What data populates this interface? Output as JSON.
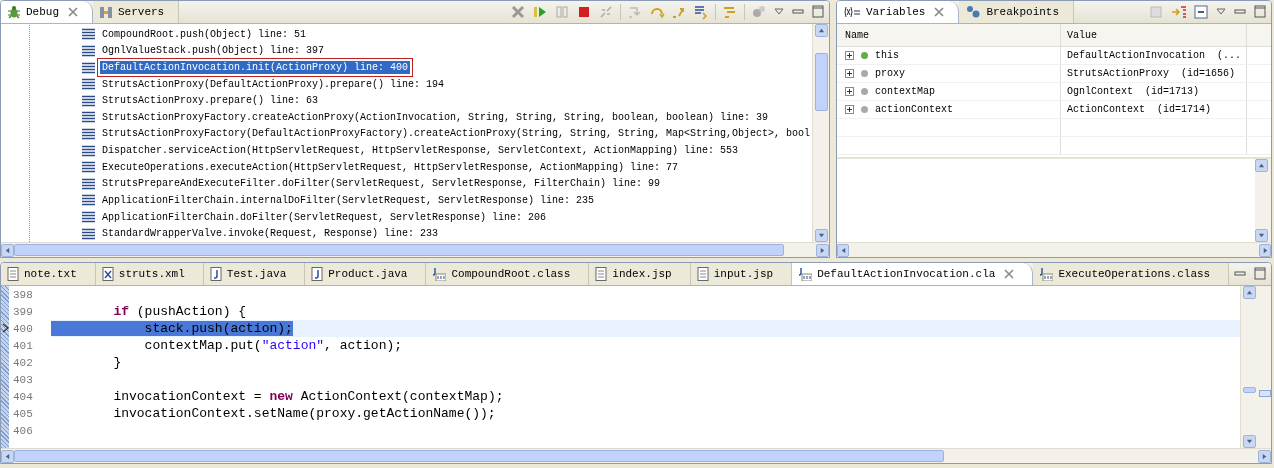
{
  "debug_view": {
    "tabs": [
      {
        "label": "Debug",
        "selected": true
      },
      {
        "label": "Servers",
        "selected": false
      }
    ],
    "frames": [
      {
        "text": "CompoundRoot.push(Object) line: 51",
        "selected": false
      },
      {
        "text": "OgnlValueStack.push(Object) line: 397",
        "selected": false
      },
      {
        "text": "DefaultActionInvocation.init(ActionProxy) line: 400",
        "selected": true
      },
      {
        "text": "StrutsActionProxy(DefaultActionProxy).prepare() line: 194",
        "selected": false
      },
      {
        "text": "StrutsActionProxy.prepare() line: 63",
        "selected": false
      },
      {
        "text": "StrutsActionProxyFactory.createActionProxy(ActionInvocation, String, String, String, boolean, boolean) line: 39",
        "selected": false
      },
      {
        "text": "StrutsActionProxyFactory(DefaultActionProxyFactory).createActionProxy(String, String, String, Map<String,Object>, bool",
        "selected": false
      },
      {
        "text": "Dispatcher.serviceAction(HttpServletRequest, HttpServletResponse, ServletContext, ActionMapping) line: 553",
        "selected": false
      },
      {
        "text": "ExecuteOperations.executeAction(HttpServletRequest, HttpServletResponse, ActionMapping) line: 77",
        "selected": false
      },
      {
        "text": "StrutsPrepareAndExecuteFilter.doFilter(ServletRequest, ServletResponse, FilterChain) line: 99",
        "selected": false
      },
      {
        "text": "ApplicationFilterChain.internalDoFilter(ServletRequest, ServletResponse) line: 235",
        "selected": false
      },
      {
        "text": "ApplicationFilterChain.doFilter(ServletRequest, ServletResponse) line: 206",
        "selected": false
      },
      {
        "text": "StandardWrapperValve.invoke(Request, Response) line: 233",
        "selected": false
      }
    ]
  },
  "variables_view": {
    "tabs": [
      {
        "label": "Variables",
        "selected": true
      },
      {
        "label": "Breakpoints",
        "selected": false
      }
    ],
    "columns": [
      "Name",
      "Value"
    ],
    "rows": [
      {
        "name": "this",
        "value": "DefaultActionInvocation  (...",
        "color": "#5fae4a"
      },
      {
        "name": "proxy",
        "value": "StrutsActionProxy  (id=1656)",
        "color": "#a9a9a9"
      },
      {
        "name": "contextMap",
        "value": "OgnlContext  (id=1713)",
        "color": "#a9a9a9"
      },
      {
        "name": "actionContext",
        "value": "ActionContext  (id=1714)",
        "color": "#a9a9a9"
      }
    ]
  },
  "editor": {
    "tabs": [
      {
        "label": "note.txt",
        "kind": "text",
        "selected": false
      },
      {
        "label": "struts.xml",
        "kind": "xml",
        "selected": false
      },
      {
        "label": "Test.java",
        "kind": "java",
        "selected": false
      },
      {
        "label": "Product.java",
        "kind": "java",
        "selected": false
      },
      {
        "label": "CompoundRoot.class",
        "kind": "class",
        "selected": false
      },
      {
        "label": "index.jsp",
        "kind": "text",
        "selected": false
      },
      {
        "label": "input.jsp",
        "kind": "text",
        "selected": false
      },
      {
        "label": "DefaultActionInvocation.cla",
        "kind": "class",
        "selected": true
      },
      {
        "label": "ExecuteOperations.class",
        "kind": "class",
        "selected": false
      }
    ],
    "lines": [
      {
        "number": "398",
        "current": false
      },
      {
        "number": "399",
        "current": false,
        "tokens": [
          {
            "text": "        if",
            "kind": "keyword",
            "selected": false
          },
          {
            "text": " (pushAction) {",
            "kind": "plain",
            "selected": false
          }
        ]
      },
      {
        "number": "400",
        "current": true,
        "tokens": [
          {
            "text": "            stack.push(action);",
            "kind": "plain",
            "selected": true
          }
        ]
      },
      {
        "number": "401",
        "current": false,
        "tokens": [
          {
            "text": "            contextMap.put(",
            "kind": "plain",
            "selected": false
          },
          {
            "text": "\"action\"",
            "kind": "string",
            "selected": false
          },
          {
            "text": ", action);",
            "kind": "plain",
            "selected": false
          }
        ]
      },
      {
        "number": "402",
        "current": false,
        "tokens": [
          {
            "text": "        }",
            "kind": "plain",
            "selected": false
          }
        ]
      },
      {
        "number": "403",
        "current": false
      },
      {
        "number": "404",
        "current": false,
        "tokens": [
          {
            "text": "        invocationContext = ",
            "kind": "plain",
            "selected": false
          },
          {
            "text": "new",
            "kind": "keyword",
            "selected": false
          },
          {
            "text": " ActionContext(contextMap);",
            "kind": "plain",
            "selected": false
          }
        ]
      },
      {
        "number": "405",
        "current": false,
        "tokens": [
          {
            "text": "        invocationContext.setName(proxy.getActionName());",
            "kind": "plain",
            "selected": false
          }
        ]
      },
      {
        "number": "406",
        "current": false
      }
    ]
  }
}
